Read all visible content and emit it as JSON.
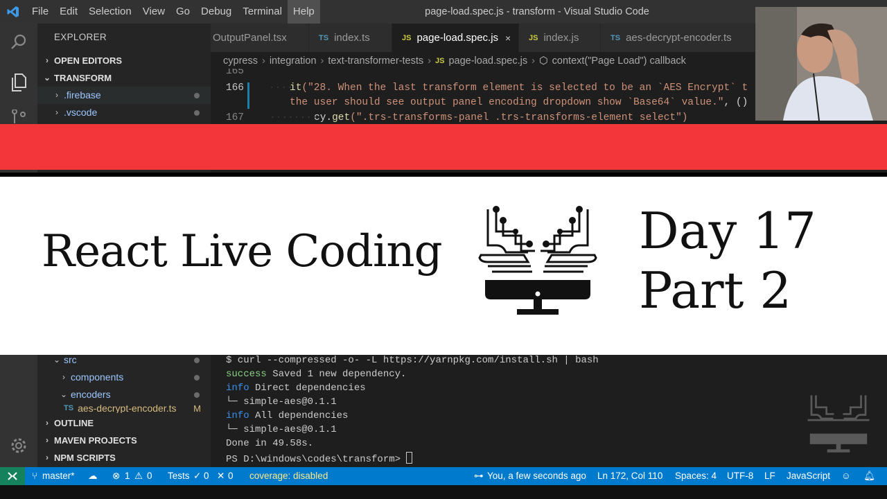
{
  "window": {
    "title": "page-load.spec.js - transform - Visual Studio Code"
  },
  "menu": [
    "File",
    "Edit",
    "Selection",
    "View",
    "Go",
    "Debug",
    "Terminal",
    "Help"
  ],
  "sidebar": {
    "title": "EXPLORER",
    "open_editors": "OPEN EDITORS",
    "project": "TRANSFORM",
    "items": [
      {
        "label": ".firebase"
      },
      {
        "label": ".vscode"
      }
    ],
    "lower_items": [
      {
        "label": "src"
      },
      {
        "label": "components"
      },
      {
        "label": "encoders"
      },
      {
        "label": "aes-decrypt-encoder.ts",
        "badge": "M"
      }
    ],
    "outline": "OUTLINE",
    "maven": "MAVEN PROJECTS",
    "npm": "NPM SCRIPTS"
  },
  "tabs": [
    {
      "label": "OutputPanel.tsx",
      "icon": ""
    },
    {
      "label": "index.ts",
      "icon": "TS"
    },
    {
      "label": "page-load.spec.js",
      "icon": "JS",
      "close": "×"
    },
    {
      "label": "index.js",
      "icon": "JS"
    },
    {
      "label": "aes-decrypt-encoder.ts",
      "icon": "TS"
    }
  ],
  "breadcrumb": [
    "cypress",
    "integration",
    "text-transformer-tests",
    "page-load.spec.js",
    "context(\"Page Load\") callback"
  ],
  "code": {
    "lines": [
      {
        "num": "165"
      },
      {
        "num": "166",
        "text_kw": "it",
        "text_str": "(\"28. When the last transform element is selected to be an `AES Encrypt` t"
      },
      {
        "num": "",
        "text_str": "the user should see output panel encoding dropdown show `Base64` value.\"",
        "text_tail": ", ()"
      },
      {
        "num": "167",
        "text_pre": "cy.",
        "text_kw": "get",
        "text_str": "(\".trs-transforms-panel .trs-transforms-element select\")"
      }
    ]
  },
  "banner": {
    "title": "React Live Coding",
    "day": "Day 17",
    "part": "Part 2"
  },
  "terminal": {
    "lines": [
      {
        "text": "$ curl --compressed -o- -L https://yarnpkg.com/install.sh | bash"
      },
      {
        "prefix": "success",
        "text": " Saved 1 new dependency.",
        "color": "green"
      },
      {
        "prefix": "info",
        "text": " Direct dependencies",
        "color": "blue"
      },
      {
        "text": "└─ simple-aes@0.1.1"
      },
      {
        "prefix": "info",
        "text": " All dependencies",
        "color": "blue"
      },
      {
        "text": "└─ simple-aes@0.1.1"
      },
      {
        "text": "Done in 49.58s."
      },
      {
        "text": "PS D:\\windows\\codes\\transform> "
      }
    ]
  },
  "statusbar": {
    "branch": "master*",
    "errors": "1",
    "warnings": "0",
    "tests_label": "Tests",
    "tests_pass": "0",
    "tests_fail": "0",
    "coverage": "coverage: disabled",
    "blame": "You, a few seconds ago",
    "position": "Ln 172, Col 110",
    "spaces": "Spaces: 4",
    "encoding": "UTF-8",
    "eol": "LF",
    "language": "JavaScript"
  },
  "colors": {
    "accent": "#007acc",
    "banner_red": "#f2363a",
    "remote": "#16825d"
  }
}
